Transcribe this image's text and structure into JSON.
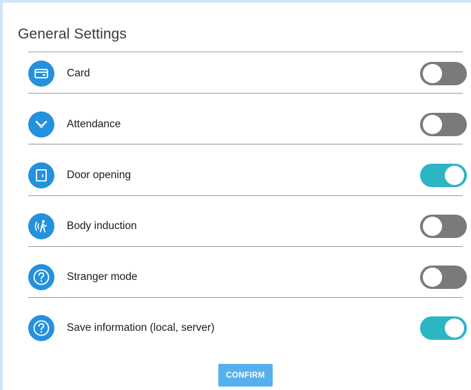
{
  "page": {
    "title": "General Settings"
  },
  "settings": [
    {
      "label": "Card",
      "icon": "card-icon",
      "enabled": false
    },
    {
      "label": "Attendance",
      "icon": "clock-icon",
      "enabled": false
    },
    {
      "label": "Door opening",
      "icon": "door-icon",
      "enabled": true
    },
    {
      "label": "Body induction",
      "icon": "body-motion-icon",
      "enabled": false
    },
    {
      "label": "Stranger mode",
      "icon": "help-icon",
      "enabled": false
    },
    {
      "label": "Save information (local, server)",
      "icon": "help-icon",
      "enabled": true
    }
  ],
  "actions": {
    "confirm_label": "CONFIRM"
  },
  "colors": {
    "icon_bg": "#2391dd",
    "toggle_on": "#2bb6c2",
    "toggle_off": "#7a7a7a",
    "confirm_bg": "#57b0ee"
  }
}
